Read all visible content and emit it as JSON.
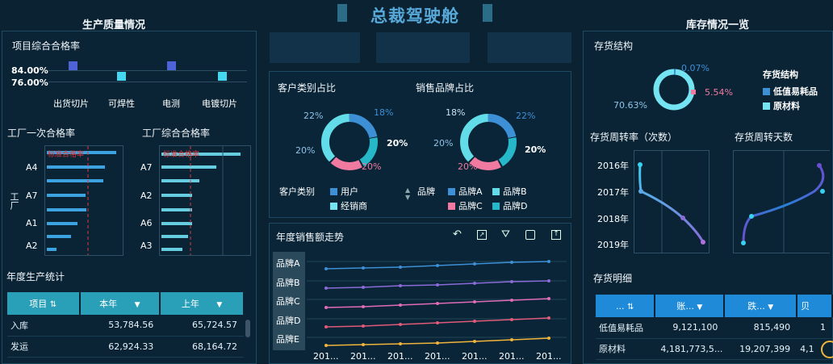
{
  "header": {
    "title": "总裁驾驶舱",
    "left_section": "生产质量情况",
    "right_section": "库存情况一览"
  },
  "quality": {
    "title": "项目综合合格率",
    "y_ticks": [
      "84.00%",
      "76.00%"
    ],
    "categories": [
      "出货切片",
      "可焊性",
      "电测",
      "电镀切片"
    ],
    "colors": {
      "high": "#4f63d8",
      "low": "#45d6f0"
    }
  },
  "factory_first": {
    "title": "工厂一次合格率",
    "y_labels": [
      "A4",
      "A7",
      "A1",
      "A2"
    ],
    "y_axis_label": "工厂",
    "ref_label": "标准合格率"
  },
  "factory_total": {
    "title": "工厂综合合格率",
    "y_labels": [
      "A7",
      "A2",
      "A6",
      "A3"
    ],
    "ref_label": "标准合格率"
  },
  "annual_prod": {
    "title": "年度生产统计",
    "headers": [
      "项目",
      "本年",
      "上年"
    ],
    "rows": [
      [
        "入库",
        "53,784.56",
        "65,724.57"
      ],
      [
        "发运",
        "62,924.33",
        "68,164.72"
      ]
    ]
  },
  "customer": {
    "title": "客户类别占比",
    "labels": [
      "22%",
      "18%",
      "20%",
      "20%",
      "20%"
    ],
    "legend_title": "客户类别",
    "legend": [
      {
        "name": "用户",
        "color": "#3d8fd6"
      },
      {
        "name": "经销商",
        "color": "#74e3f2"
      }
    ]
  },
  "brand": {
    "title": "销售品牌占比",
    "labels": [
      "18%",
      "22%",
      "20%",
      "20%",
      "20%"
    ],
    "legend_title": "品牌",
    "legend": [
      {
        "name": "品牌A",
        "color": "#3d8fd6"
      },
      {
        "name": "品牌B",
        "color": "#62dce8"
      },
      {
        "name": "品牌C",
        "color": "#f07aa0"
      },
      {
        "name": "品牌D",
        "color": "#26b7c9"
      }
    ]
  },
  "sales_trend": {
    "title": "年度销售额走势",
    "rows": [
      "品牌A",
      "品牌B",
      "品牌C",
      "品牌D",
      "品牌E"
    ],
    "x_ticks": [
      "201...",
      "201...",
      "201...",
      "201...",
      "201...",
      "201...",
      "201..."
    ],
    "colors": [
      "#3d8fd6",
      "#8a6bd8",
      "#e06cb8",
      "#e05a7a",
      "#f0b43a"
    ]
  },
  "inventory_structure": {
    "title": "存货结构",
    "labels": [
      "0.07%",
      "5.54%",
      "70.63%"
    ],
    "legend_title": "存货结构",
    "legend": [
      {
        "name": "低值易耗品",
        "color": "#3d8fd6"
      },
      {
        "name": "原材料",
        "color": "#74e3f2"
      }
    ]
  },
  "turnover_rate": {
    "title": "存货周转率（次数）",
    "years": [
      "2016年",
      "2017年",
      "2018年",
      "2019年"
    ]
  },
  "turnover_days": {
    "title": "存货周转天数"
  },
  "inventory_detail": {
    "title": "存货明细",
    "headers": [
      "...",
      "账...",
      "跌...",
      "贝"
    ],
    "rows": [
      [
        "低值易耗品",
        "9,121,100",
        "815,490",
        "1"
      ],
      [
        "原材料",
        "4,181,773,5...",
        "19,207,399",
        "4,1"
      ]
    ]
  },
  "toolbar": {
    "icons": [
      "undo-icon",
      "expand-icon",
      "filter-icon",
      "export-icon",
      "share-icon"
    ]
  }
}
